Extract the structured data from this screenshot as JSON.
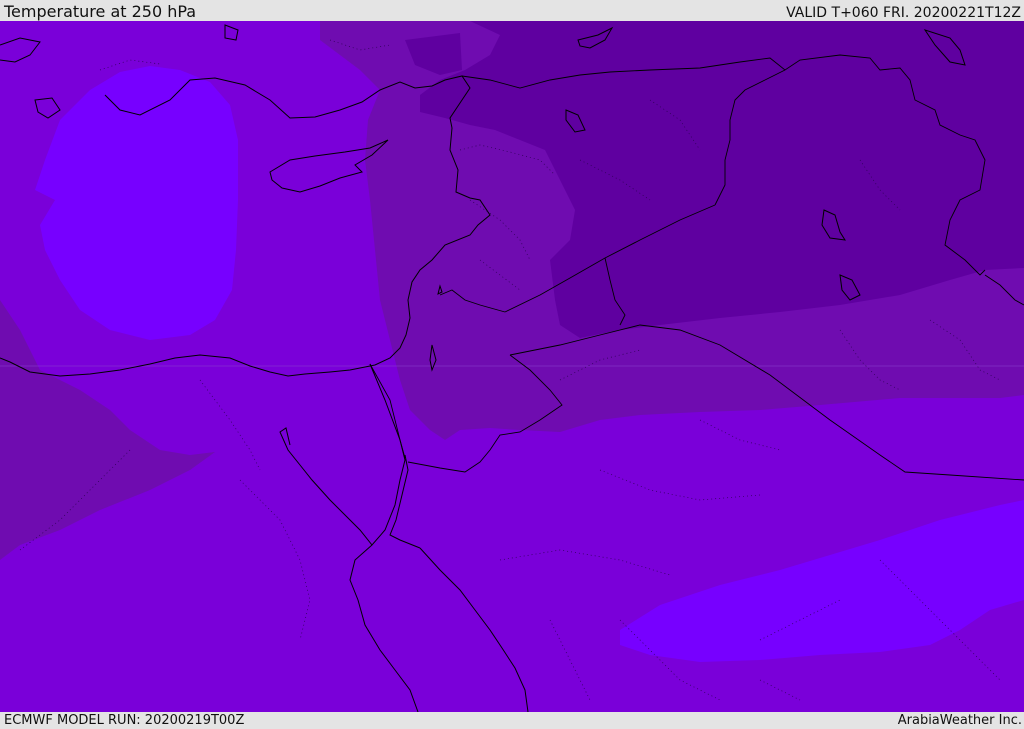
{
  "header": {
    "title": "Temperature at 250 hPa",
    "valid": "VALID T+060 FRI. 20200221T12Z"
  },
  "footer": {
    "model_run": "ECMWF MODEL RUN: 20200219T00Z",
    "credit": "ArabiaWeather Inc."
  },
  "map": {
    "fill_colors": {
      "coldest": "#5f00a0",
      "very_cold": "#6f0cb0",
      "cold": "#7a00d9",
      "cool": "#7700ff"
    }
  }
}
